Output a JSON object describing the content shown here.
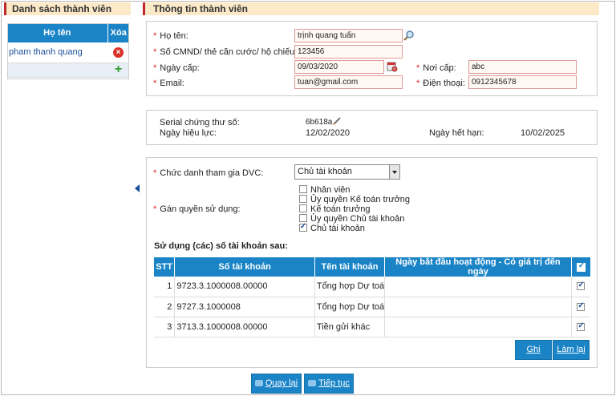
{
  "left_panel": {
    "title": "Danh sách thành viên",
    "col_name": "Họ tên",
    "col_delete": "Xóa",
    "members": [
      {
        "name": "pham thanh quang"
      }
    ]
  },
  "right_panel": {
    "title": "Thông tin thành viên"
  },
  "personal": {
    "fullname_label": "Họ tên:",
    "fullname_value": "trịnh quang tuấn",
    "id_label": "Số CMND/ thẻ căn cước/ hộ chiếu:",
    "id_value": "123456",
    "issue_date_label": "Ngày cấp:",
    "issue_date_value": "09/03/2020",
    "issue_place_label": "Nơi cấp:",
    "issue_place_value": "abc",
    "email_label": "Email:",
    "email_value": "tuan@gmail.com",
    "phone_label": "Điện thoại:",
    "phone_value": "0912345678"
  },
  "certificate": {
    "serial_label": "Serial chứng thư số:",
    "serial_value": "6b618a",
    "valid_from_label": "Ngày hiệu lực:",
    "valid_from_value": "12/02/2020",
    "valid_to_label": "Ngày hết hạn:",
    "valid_to_value": "10/02/2025"
  },
  "role": {
    "position_label": "Chức danh tham gia DVC:",
    "position_value": "Chủ tài khoản",
    "permission_label": "Gán quyền sử dụng:",
    "permissions": [
      {
        "label": "Nhân viên",
        "checked": false
      },
      {
        "label": "Ủy quyền Kế toán trưởng",
        "checked": false
      },
      {
        "label": "Kế toán trưởng",
        "checked": false
      },
      {
        "label": "Ủy quyền Chủ tài khoản",
        "checked": false
      },
      {
        "label": "Chủ tài khoản",
        "checked": true
      }
    ]
  },
  "accounts": {
    "title": "Sử dụng (các) số tài khoản sau:",
    "headers": [
      "STT",
      "Số tài khoản",
      "Tên tài khoản",
      "Ngày bắt đầu hoạt động - Có giá trị đến ngày"
    ],
    "rows": [
      {
        "stt": "1",
        "number": "9723.3.1000008.00000",
        "name": "Tổng hợp Dự toá",
        "checked": true
      },
      {
        "stt": "2",
        "number": "9727.3.1000008",
        "name": "Tổng hợp Dự toá",
        "checked": true
      },
      {
        "stt": "3",
        "number": "3713.3.1000008.00000",
        "name": "Tiền gửi khác",
        "checked": true
      }
    ]
  },
  "buttons": {
    "save": "Ghi",
    "reset": "Làm lại",
    "back": "Quay lại",
    "next": "Tiếp tục"
  },
  "colors": {
    "accent_blue": "#1a84c7",
    "header_bg": "#fbe9c8",
    "header_bar": "#c0272d"
  }
}
